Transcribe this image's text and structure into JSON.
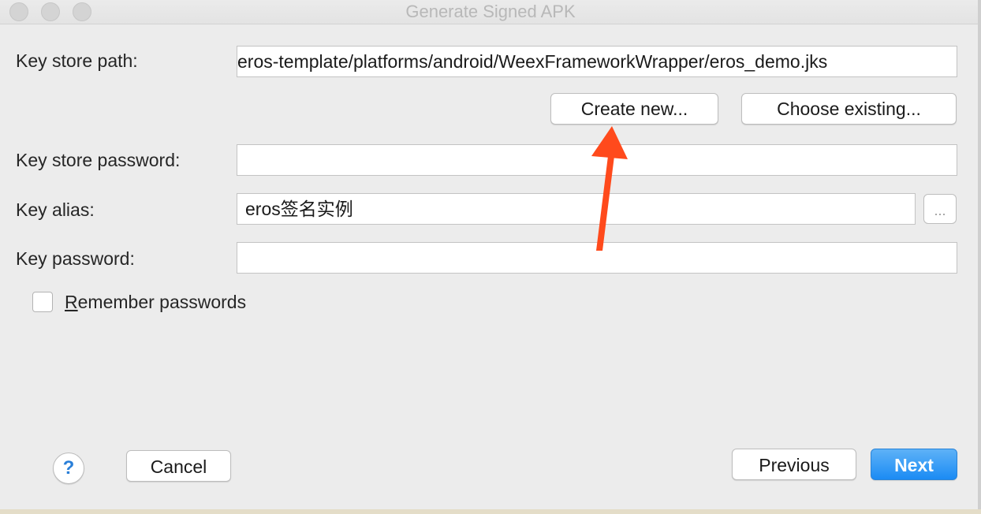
{
  "window": {
    "title": "Generate Signed APK"
  },
  "form": {
    "key_store_path_label": "Key store path:",
    "key_store_path_value": "eros-template/platforms/android/WeexFrameworkWrapper/eros_demo.jks",
    "create_new_label": "Create new...",
    "choose_existing_label": "Choose existing...",
    "key_store_password_label": "Key store password:",
    "key_store_password_value": "",
    "key_alias_label": "Key alias:",
    "key_alias_value": "eros签名实例",
    "key_alias_browse_label": "...",
    "key_password_label": "Key password:",
    "key_password_value": "",
    "remember_label_mnemonic": "R",
    "remember_label_rest": "emember passwords",
    "remember_checked": false
  },
  "footer": {
    "help_label": "?",
    "cancel_label": "Cancel",
    "previous_label": "Previous",
    "next_label": "Next"
  },
  "annotation": {
    "arrow_color": "#ff4a1c"
  },
  "colors": {
    "primary_button": "#1b8bf4",
    "help_icon": "#2a7fd8"
  }
}
